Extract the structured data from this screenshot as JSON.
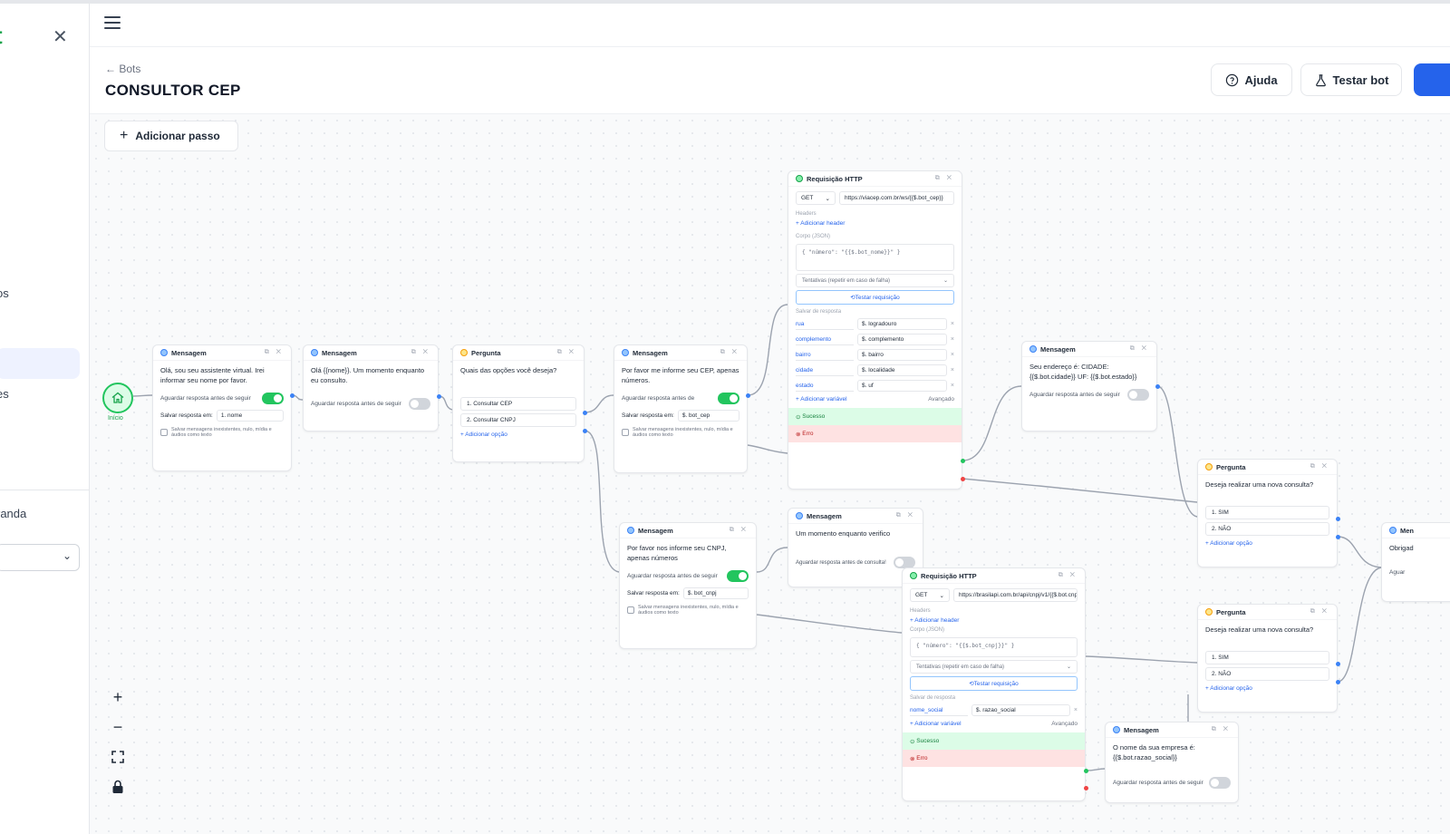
{
  "sidebar": {
    "logo": "t",
    "items": [
      {
        "label": "os"
      },
      {
        "label": "es"
      },
      {
        "label": "randa"
      }
    ]
  },
  "header": {
    "back_label": "← Bots",
    "title": "CONSULTOR CEP",
    "help_label": "Ajuda",
    "test_label": "Testar bot"
  },
  "canvas": {
    "add_step_label": "Adicionar passo",
    "start_label": "Início"
  },
  "labels": {
    "wait": "Aguardar resposta antes de seguir",
    "wait_short": "Aguardar resposta antes de",
    "save_in": "Salvar resposta em:",
    "save_multi": "Salvar mensagens inexistentes, nulo, mídia e áudios como texto",
    "add_option": "+ Adicionar opção",
    "headers": "Headers",
    "add_header": "+ Adicionar header",
    "body": "Corpo (JSON)",
    "retries": "Tentativas (repetir em caso de falha)",
    "test_request": "Testar requisição",
    "save_response": "Salvar de resposta",
    "add_variable": "+ Adicionar variável",
    "advanced": "Avançado",
    "success": "Sucesso",
    "error": "Erro"
  },
  "nodes": {
    "m1": {
      "type": "Mensagem",
      "text": "Olá, sou seu assistente virtual. Irei informar seu nome por favor.",
      "save": "1. nome"
    },
    "m2": {
      "type": "Mensagem",
      "text": "Olá {{nome}}. Um momento enquanto eu consulto."
    },
    "p1": {
      "type": "Pergunta",
      "text": "Quais das opções você deseja?",
      "options": [
        "1. Consultar CEP",
        "2. Consultar CNPJ"
      ]
    },
    "m3": {
      "type": "Mensagem",
      "text": "Por favor me informe seu CEP, apenas números.",
      "save": "$. bot_cep"
    },
    "h1": {
      "type": "Requisição HTTP",
      "method": "GET",
      "url": "https://viacep.com.br/ws/{{$.bot_cep}}",
      "body": "{ \"número\": \"{{$.bot_nome}}\" }",
      "vars": [
        {
          "k": "rua",
          "v": "$. logradouro"
        },
        {
          "k": "complemento",
          "v": "$. complemento"
        },
        {
          "k": "bairro",
          "v": "$. bairro"
        },
        {
          "k": "cidade",
          "v": "$. localidade"
        },
        {
          "k": "estado",
          "v": "$. uf"
        }
      ]
    },
    "m4": {
      "type": "Mensagem",
      "text": "Seu endereço é: CIDADE: {{$.bot.cidade}} UF: {{$.bot.estado}}"
    },
    "p2": {
      "type": "Pergunta",
      "text": "Deseja realizar uma nova consulta?",
      "options": [
        "1. SIM",
        "2. NÃO"
      ]
    },
    "m5": {
      "type": "Mensagem",
      "text": "Por favor nos informe seu CNPJ, apenas números",
      "save": "$. bot_cnpj"
    },
    "m6": {
      "type": "Mensagem",
      "text": "Um momento enquanto verifico",
      "wait": "Aguardar resposta antes de consulta!"
    },
    "h2": {
      "type": "Requisição HTTP",
      "method": "GET",
      "url": "https://brasilapi.com.br/api/cnpj/v1/{{$.bot.cnpj}}",
      "body": "{ \"número\": \"{{$.bot_cnpj}}\" }",
      "vars": [
        {
          "k": "nome_social",
          "v": "$. razao_social"
        }
      ]
    },
    "p3": {
      "type": "Pergunta",
      "text": "Deseja realizar uma nova consulta?",
      "options": [
        "1. SIM",
        "2. NÃO"
      ]
    },
    "m7": {
      "type": "Mensagem",
      "text": "O nome da sua empresa é: {{$.bot.razao_social}}"
    },
    "m8": {
      "type": "Men",
      "text": "Obrigad",
      "wait": "Aguar"
    }
  }
}
